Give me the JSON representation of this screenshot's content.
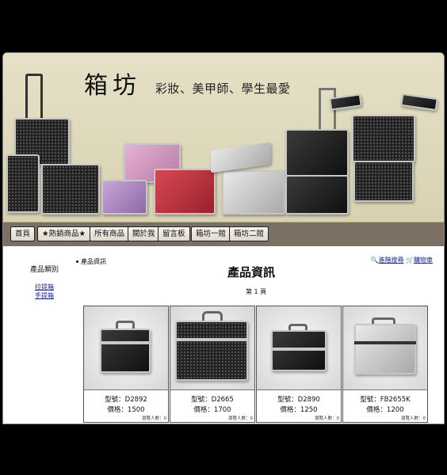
{
  "banner": {
    "brand": "箱坊",
    "slogan": "彩妝、美甲師、學生最愛"
  },
  "nav": [
    "首頁",
    "★熱銷商品★",
    "所有商品",
    "關於我",
    "留言板",
    "箱坊一館",
    "箱坊二館"
  ],
  "sidebar": {
    "title": "產品類別",
    "links": [
      "拉提箱",
      "手提箱"
    ]
  },
  "breadcrumb": "產品資訊",
  "page_title": "產品資訊",
  "top_links": {
    "search": "進階搜尋",
    "cart": "購物車"
  },
  "page_number": "第 1 頁",
  "products": [
    {
      "model": "型號：D2892",
      "price": "價格：1500",
      "views": "瀏覽人數：0"
    },
    {
      "model": "型號：D2665",
      "price": "價格：1700",
      "views": "瀏覽人數：0"
    },
    {
      "model": "型號：D2890",
      "price": "價格：1250",
      "views": "瀏覽人數：0"
    },
    {
      "model": "型號：FB2655K",
      "price": "價格：1200",
      "views": "瀏覽人數：0"
    }
  ],
  "colors": {
    "banner_bg": "#e3ddc2",
    "navbar_bg": "#7c6f64",
    "link": "#1a2a8a"
  }
}
